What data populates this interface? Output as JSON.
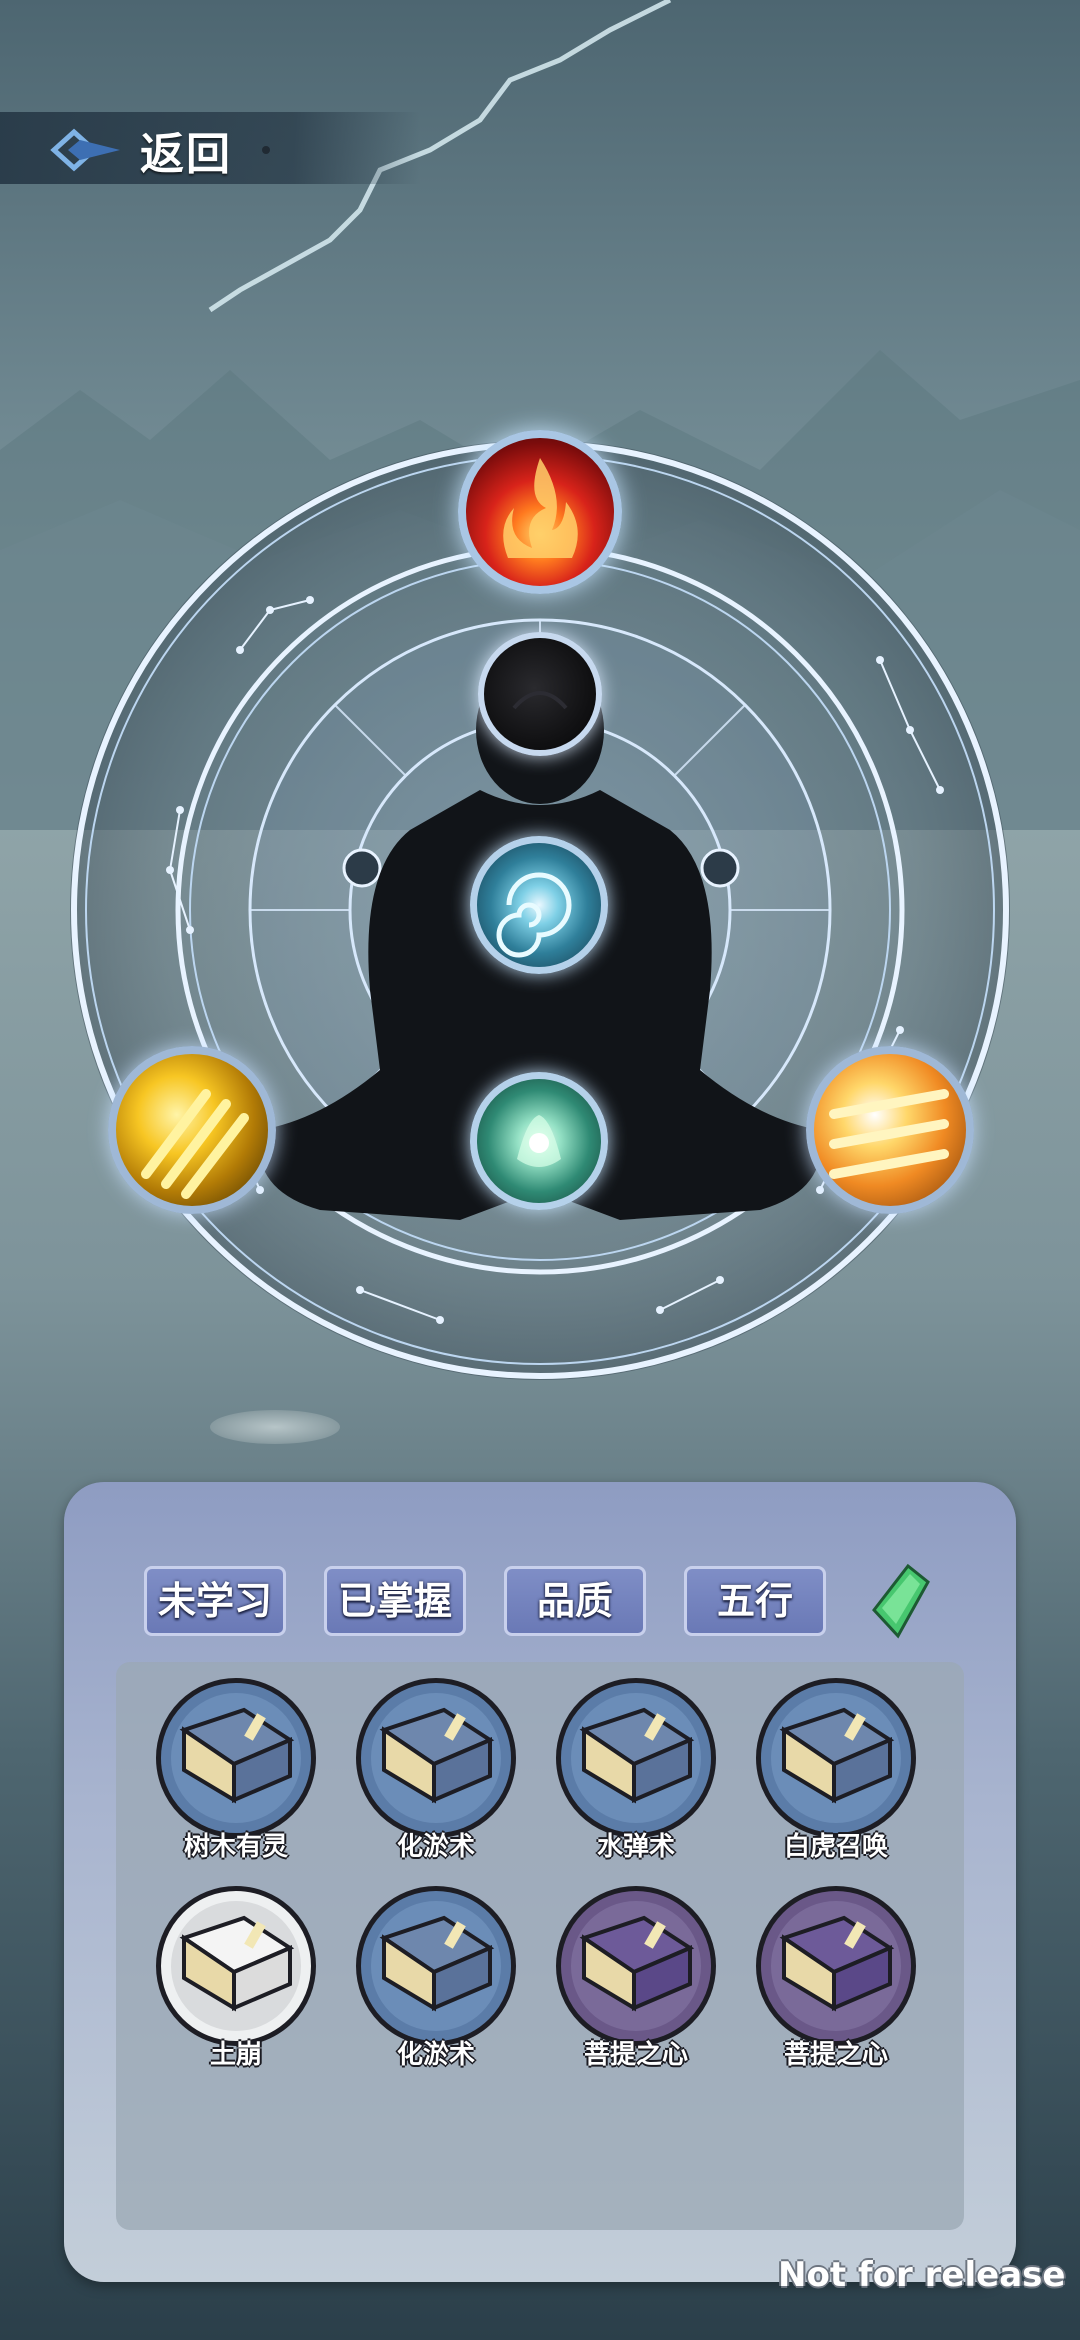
{
  "header": {
    "back_label": "返回"
  },
  "skill_wheel": {
    "slots": [
      {
        "element": "fire",
        "icon": "fire-skill-icon"
      },
      {
        "element": "dark",
        "icon": "dark-orb-icon"
      },
      {
        "element": "water",
        "icon": "water-vortex-icon"
      },
      {
        "element": "wood",
        "icon": "green-hand-icon"
      },
      {
        "element": "metal",
        "icon": "golden-swords-icon"
      },
      {
        "element": "metal",
        "icon": "golden-blades-icon"
      }
    ]
  },
  "filters": [
    {
      "label": "未学习"
    },
    {
      "label": "已掌握"
    },
    {
      "label": "品质"
    },
    {
      "label": "五行"
    }
  ],
  "books": [
    {
      "name": "树木有灵",
      "rarity": "blue"
    },
    {
      "name": "化淤术",
      "rarity": "blue"
    },
    {
      "name": "水弹术",
      "rarity": "blue"
    },
    {
      "name": "白虎召唤",
      "rarity": "blue"
    },
    {
      "name": "土崩",
      "rarity": "white"
    },
    {
      "name": "化淤术",
      "rarity": "blue"
    },
    {
      "name": "菩提之心",
      "rarity": "purple"
    },
    {
      "name": "菩提之心",
      "rarity": "purple"
    }
  ],
  "watermark": "Not for release",
  "colors": {
    "panel": "#a8b4cf",
    "filter_button": "#7381bd",
    "rarity_blue": "#6b8db8",
    "rarity_purple": "#7a6a99",
    "rarity_white": "#d9dbdd"
  }
}
